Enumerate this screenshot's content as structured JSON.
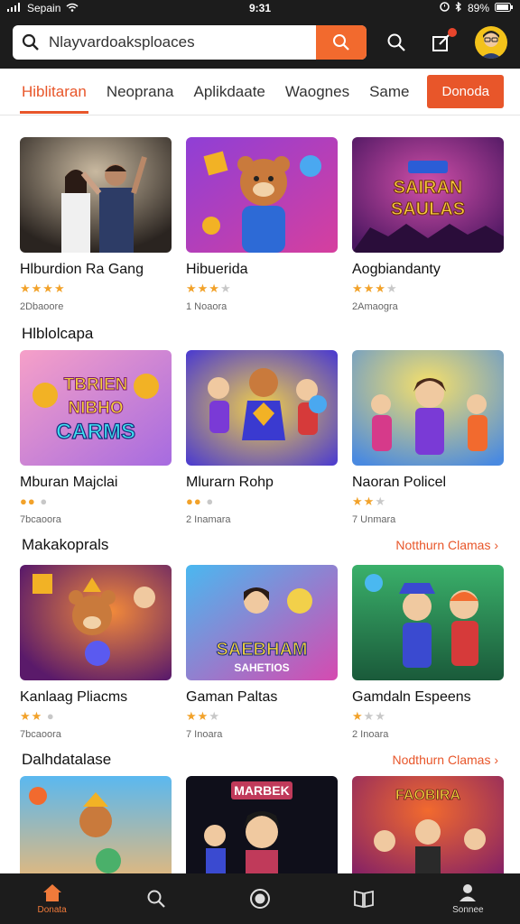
{
  "status": {
    "carrier": "Sepain",
    "time": "9:31",
    "battery": "89%"
  },
  "search": {
    "value": "Nlayvardoaksploaces"
  },
  "tabs": [
    {
      "label": "Hiblitaran",
      "active": true
    },
    {
      "label": "Neoprana",
      "active": false
    },
    {
      "label": "Aplikdaate",
      "active": false
    },
    {
      "label": "Waognes",
      "active": false
    },
    {
      "label": "Same",
      "active": false
    }
  ],
  "tab_cta": "Donoda",
  "sections": [
    {
      "title": "",
      "link": "",
      "cards": [
        {
          "title": "Hlburdion Ra Gang",
          "rating": 4,
          "meta": "2Dbaoore"
        },
        {
          "title": "Hibuerida",
          "rating": 3.5,
          "meta": "1 Noaora"
        },
        {
          "title": "Aogbiandanty",
          "rating": 2.5,
          "meta": "2Amaogra"
        }
      ]
    },
    {
      "title": "Hlblolcapa",
      "link": "",
      "cards": [
        {
          "title": "Mburan Majclai",
          "rating": 2,
          "meta": "7bcaoora"
        },
        {
          "title": "Mlurarn Rohp",
          "rating": 2.5,
          "meta": "2 Inamara"
        },
        {
          "title": "Naoran Policel",
          "rating": 2.5,
          "meta": "7 Unmara"
        }
      ]
    },
    {
      "title": "Makakoprals",
      "link": "Notthurn Clamas ›",
      "cards": [
        {
          "title": "Kanlaag Pliacms",
          "rating": 2,
          "meta": "7bcaoora"
        },
        {
          "title": "Gaman Paltas",
          "rating": 2.5,
          "meta": "7 Inoara"
        },
        {
          "title": "Gamdaln Espeens",
          "rating": 1.5,
          "meta": "2 Inoara"
        }
      ]
    },
    {
      "title": "Dalhdatalase",
      "link": "Nodthurn Clamas ›",
      "cards": [
        {
          "title": "",
          "rating": 0,
          "meta": ""
        },
        {
          "title": "",
          "rating": 0,
          "meta": ""
        },
        {
          "title": "",
          "rating": 0,
          "meta": ""
        }
      ]
    }
  ],
  "thumb_art": [
    [
      "SAIRAN",
      "SAULAS"
    ],
    [
      "TBRIEN",
      "NIBHO",
      "CARMS"
    ],
    [
      "SAEBHAM",
      "SAHETIOS"
    ],
    [
      "MARBEK"
    ],
    [
      "FAOBIRA"
    ]
  ],
  "bottom_nav": [
    {
      "label": "Donata",
      "icon": "home-icon",
      "active": true
    },
    {
      "label": "",
      "icon": "search-icon",
      "active": false
    },
    {
      "label": "",
      "icon": "record-icon",
      "active": false
    },
    {
      "label": "",
      "icon": "book-icon",
      "active": false
    },
    {
      "label": "Sonnee",
      "icon": "profile-icon",
      "active": false
    }
  ],
  "colors": {
    "accent": "#e8562a",
    "dark": "#1c1c1c",
    "star": "#f2a22a"
  }
}
